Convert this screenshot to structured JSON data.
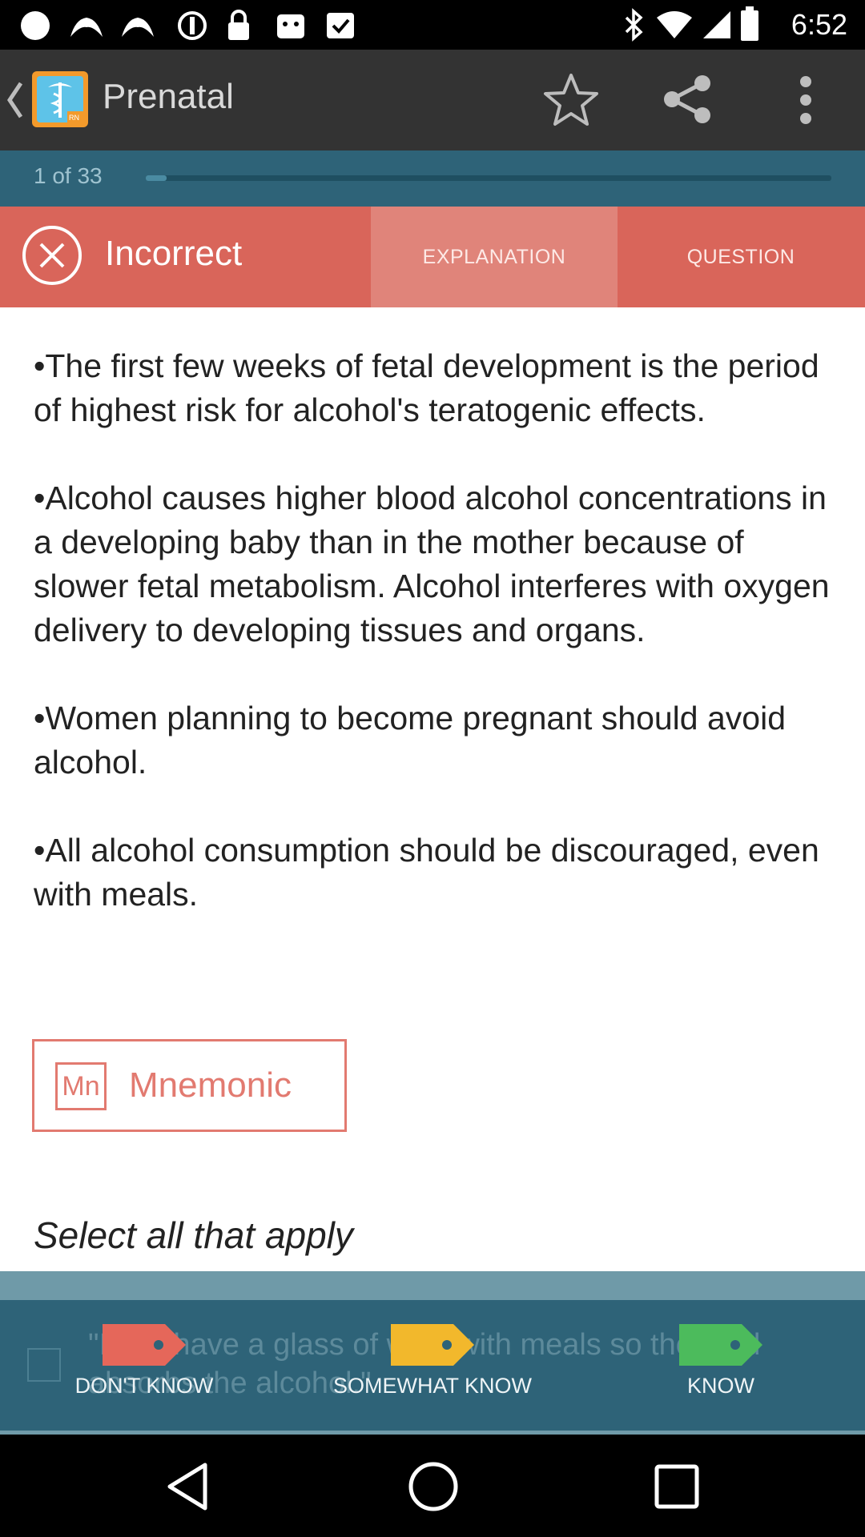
{
  "status_bar": {
    "time": "6:52",
    "icons": [
      "circle-icon",
      "wing-icon",
      "wing-icon",
      "alarm-off-icon",
      "lock-icon",
      "store-icon",
      "calendar-check-icon",
      "bluetooth-icon",
      "wifi-icon",
      "signal-icon",
      "battery-icon"
    ]
  },
  "app_bar": {
    "title": "Prenatal",
    "logo_badge": "RN",
    "icons": [
      "back-chevron-icon",
      "star-icon",
      "share-icon",
      "more-vert-icon"
    ]
  },
  "progress": {
    "label": "1 of 33",
    "current": 1,
    "total": 33
  },
  "result": {
    "label": "Incorrect",
    "tabs": [
      {
        "label": "EXPLANATION",
        "selected": true
      },
      {
        "label": "QUESTION",
        "selected": false
      }
    ]
  },
  "explanation": {
    "paragraphs": [
      "•The first few weeks of fetal development is the period of highest risk for alcohol's teratogenic effects.",
      "•Alcohol causes higher blood alcohol concentrations in a developing baby than in the mother because of slower fetal metabolism. Alcohol interferes with oxygen delivery to developing tissues and organs.",
      "•Women planning to become pregnant should avoid alcohol.",
      "•All alcohol consumption should be discouraged, even with meals."
    ]
  },
  "mnemonic": {
    "icon_text": "Mn",
    "label": "Mnemonic"
  },
  "instruction": "Select all that apply",
  "answer_preview": "\"I can have a glass of wine with meals so the food absorbs the alcohol.\"",
  "confidence": [
    {
      "label": "DON'T KNOW",
      "color": "#e5675a"
    },
    {
      "label": "SOMEWHAT KNOW",
      "color": "#f2b82c"
    },
    {
      "label": "KNOW",
      "color": "#4cbb5c"
    }
  ],
  "colors": {
    "accent_red": "#d9655a",
    "teal": "#2e6378",
    "app_bar": "#333333"
  }
}
